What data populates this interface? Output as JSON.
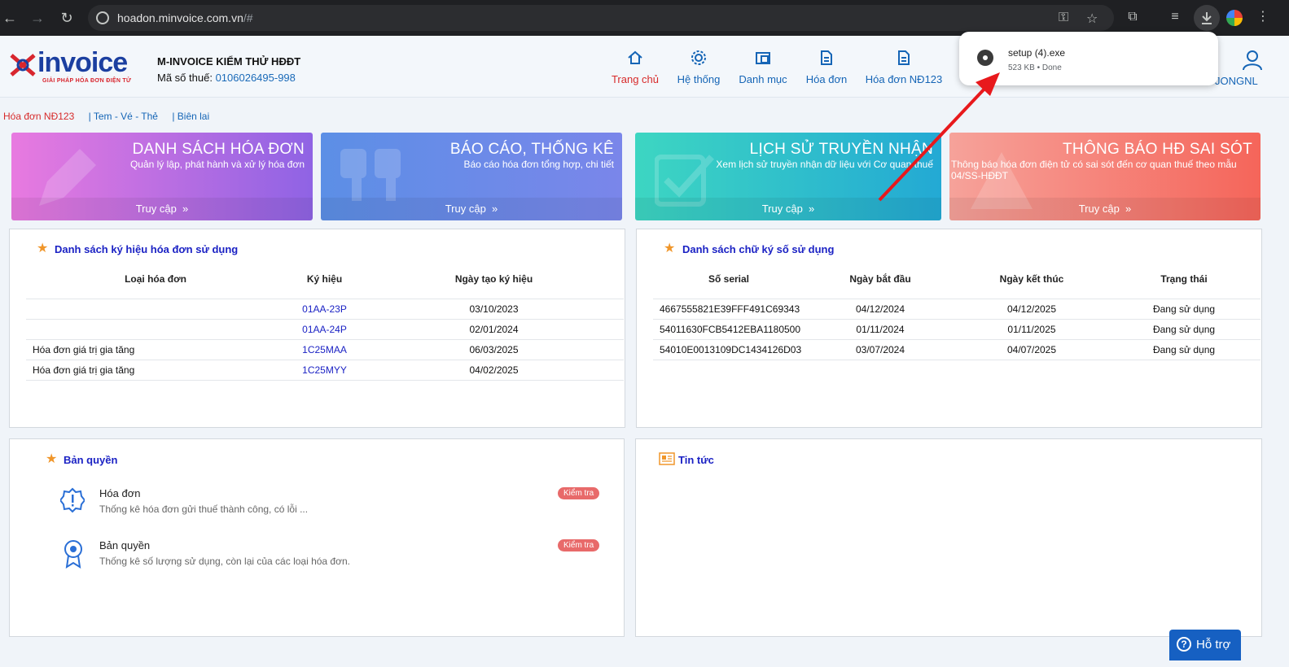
{
  "browser": {
    "url_host": "hoadon.minvoice.com.vn",
    "url_path": "/#"
  },
  "download": {
    "file_name": "setup (4).exe",
    "status": "523 KB • Done"
  },
  "header": {
    "logo_word": "invoice",
    "logo_tagline": "GIẢI PHÁP HÓA ĐƠN ĐIỆN TỬ",
    "company": "M-INVOICE KIỂM THỬ HĐĐT",
    "tax_label": "Mã số thuế:",
    "tax_code": "0106026495-998",
    "nav": [
      "Trang chủ",
      "Hệ thống",
      "Danh mục",
      "Hóa đơn",
      "Hóa đơn NĐ123"
    ],
    "user_partial": "JONGNL"
  },
  "subtabs": [
    "Hóa đơn NĐ123",
    "| Tem - Vé - Thẻ",
    "| Biên lai"
  ],
  "cards": [
    {
      "title": "DANH SÁCH HÓA ĐƠN",
      "desc": "Quản lý lập, phát hành và xử lý hóa đơn",
      "access": "Truy cập",
      "color1": "#e87ae0",
      "color2": "#8f63e4"
    },
    {
      "title": "BÁO CÁO, THỐNG KÊ",
      "desc": "Báo cáo hóa đơn tổng hợp, chi tiết",
      "access": "Truy cập",
      "color1": "#5c8fe6",
      "color2": "#7a86ea"
    },
    {
      "title": "LỊCH SỬ TRUYỀN NHẬN",
      "desc": "Xem lịch sử truyền nhận dữ liệu với Cơ quan thuế",
      "access": "Truy cập",
      "color1": "#3dd6c2",
      "color2": "#23a9d4"
    },
    {
      "title": "THÔNG BÁO HĐ SAI SÓT",
      "desc": "Thông báo hóa đơn điện tử có sai sót đến cơ quan thuế theo mẫu 04/SS-HĐĐT",
      "access": "Truy cập",
      "color1": "#f6a29a",
      "color2": "#f5655a"
    }
  ],
  "symbols_panel": {
    "title": "Danh sách ký hiệu hóa đơn sử dụng",
    "headers": [
      "Loại hóa đơn",
      "Ký hiệu",
      "Ngày tạo ký hiệu"
    ],
    "rows": [
      [
        "",
        "01AA-23P",
        "03/10/2023"
      ],
      [
        "",
        "01AA-24P",
        "02/01/2024"
      ],
      [
        "Hóa đơn giá trị gia tăng",
        "1C25MAA",
        "06/03/2025"
      ],
      [
        "Hóa đơn giá trị gia tăng",
        "1C25MYY",
        "04/02/2025"
      ]
    ]
  },
  "signature_panel": {
    "title": "Danh sách chữ ký số sử dụng",
    "headers": [
      "Số serial",
      "Ngày bắt đầu",
      "Ngày kết thúc",
      "Trạng thái"
    ],
    "rows": [
      [
        "4667555821E39FFF491C69343",
        "04/12/2024",
        "04/12/2025",
        "Đang sử dụng"
      ],
      [
        "54011630FCB5412EBA1180500",
        "01/11/2024",
        "01/11/2025",
        "Đang sử dụng"
      ],
      [
        "54010E0013109DC1434126D03",
        "03/07/2024",
        "04/07/2025",
        "Đang sử dụng"
      ]
    ]
  },
  "license_panel": {
    "title": "Bản quyền",
    "items": [
      {
        "name": "Hóa đơn",
        "desc": "Thống kê hóa đơn gửi thuế thành công, có lỗi ...",
        "badge": "Kiểm tra"
      },
      {
        "name": "Bản quyền",
        "desc": "Thống kê số lượng sử dụng, còn lại của các loại hóa đơn.",
        "badge": "Kiểm tra"
      }
    ]
  },
  "news_panel": {
    "title": "Tin tức"
  },
  "help": {
    "label": "Hỗ trợ"
  }
}
